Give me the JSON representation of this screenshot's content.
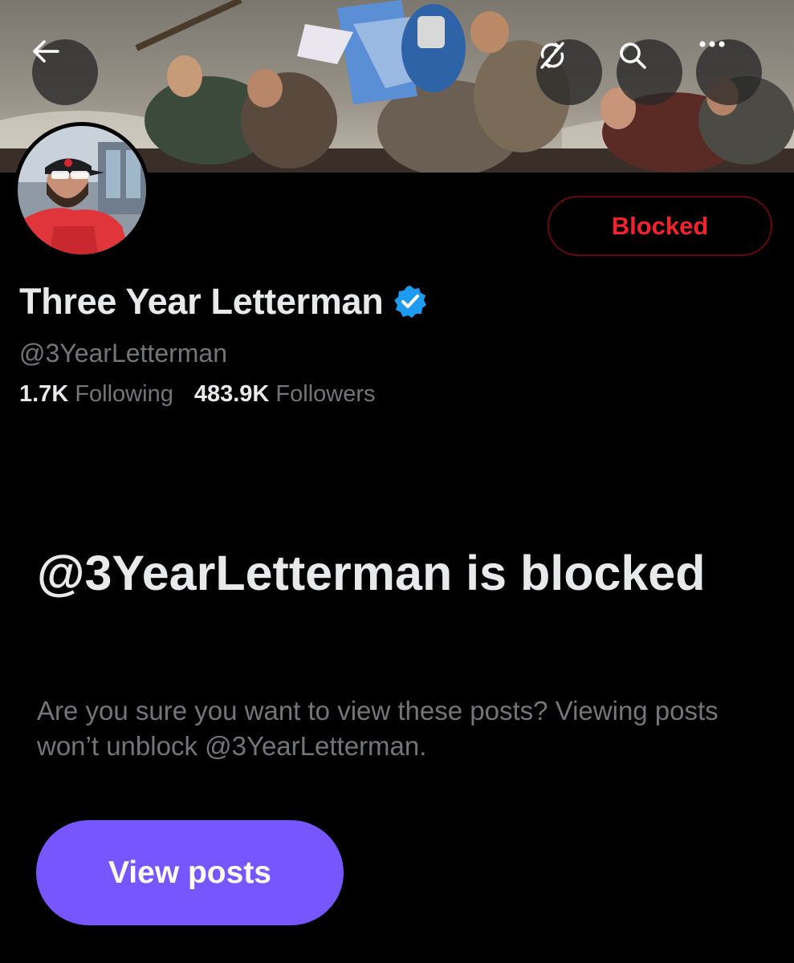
{
  "header": {
    "back_icon": "arrow-left-icon",
    "sync_icon": "sync-off-icon",
    "search_icon": "search-icon",
    "more_icon": "more-horizontal-icon"
  },
  "profile": {
    "display_name": "Three Year Letterman",
    "handle": "@3YearLetterman",
    "verified": true,
    "verified_color": "#1d9bf0",
    "blocked_label": "Blocked",
    "stats": {
      "following_count": "1.7K",
      "following_label": "Following",
      "followers_count": "483.9K",
      "followers_label": "Followers"
    }
  },
  "blocked_notice": {
    "title": "@3YearLetterman is blocked",
    "description": "Are you sure you want to view these posts? Viewing posts won’t unblock @3YearLetterman.",
    "button_label": "View posts"
  },
  "colors": {
    "accent": "#7856ff",
    "blocked_red": "#f4212e",
    "text_primary": "#e7e9ea",
    "text_secondary": "#71767b",
    "background": "#000000"
  }
}
